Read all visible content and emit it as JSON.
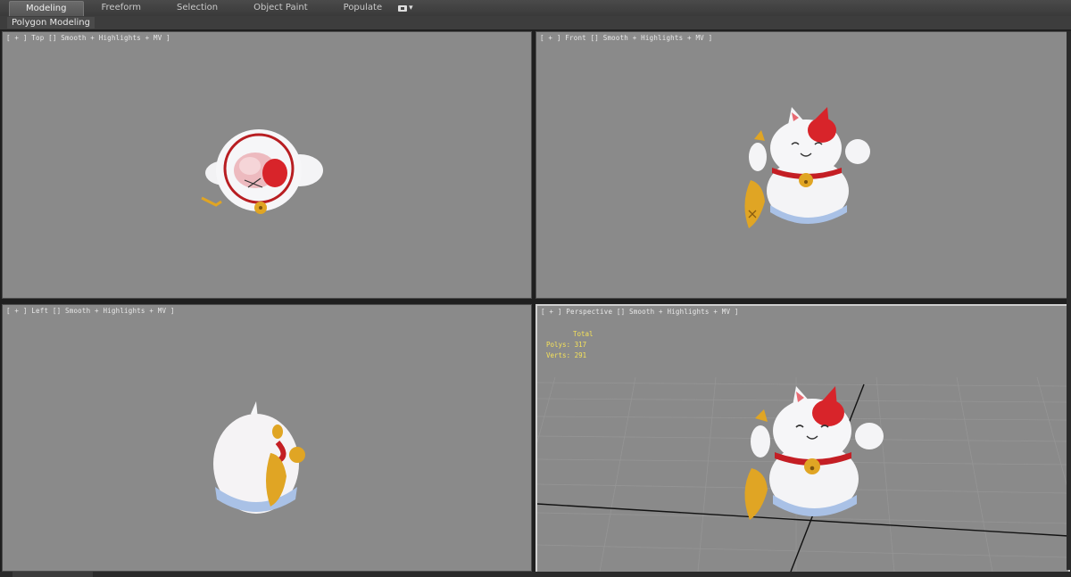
{
  "ribbon": {
    "tabs": [
      {
        "label": "Modeling",
        "active": true
      },
      {
        "label": "Freeform",
        "active": false
      },
      {
        "label": "Selection",
        "active": false
      },
      {
        "label": "Object Paint",
        "active": false
      },
      {
        "label": "Populate",
        "active": false
      }
    ],
    "extra_caret": "▾"
  },
  "subbar": {
    "label": "Polygon Modeling"
  },
  "viewports": {
    "top": {
      "label": "[ + ] Top [] Smooth + Highlights + MV ]"
    },
    "front": {
      "label": "[ + ] Front [] Smooth + Highlights + MV ]"
    },
    "left": {
      "label": "[ + ] Left [] Smooth + Highlights + MV ]"
    },
    "perspective": {
      "label": "[ + ] Perspective [] Smooth + Highlights + MV ]",
      "stats": {
        "header": "Total",
        "polys": "Polys: 317",
        "verts": "Verts: 291"
      }
    }
  },
  "colors": {
    "viewport_bg": "#8a8a8a",
    "stats_text": "#f5e25a",
    "cat_white": "#f4f4f6",
    "cat_red": "#d8242a",
    "gold": "#e0a524",
    "wave_blue": "#a9c1e6"
  }
}
